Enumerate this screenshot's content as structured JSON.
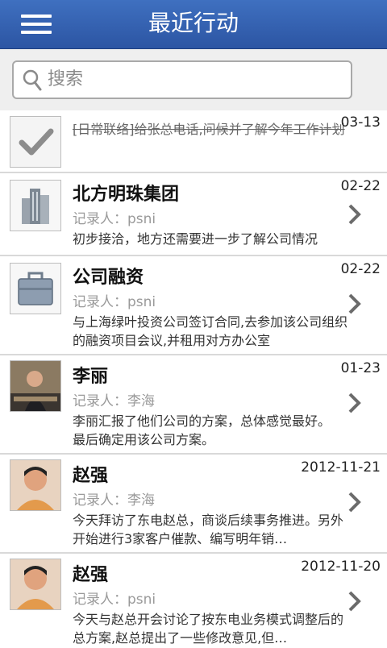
{
  "header": {
    "title": "最近行动"
  },
  "search": {
    "placeholder": "搜索"
  },
  "items": [
    {
      "title": "[日常联络]给张总电话,问候并了解今年工作计划",
      "date": "03-13",
      "recorder": "",
      "desc": ""
    },
    {
      "title": "北方明珠集团",
      "date": "02-22",
      "recorder": "记录人：psni",
      "desc": "初步接洽，地方还需要进一步了解公司情况"
    },
    {
      "title": "公司融资",
      "date": "02-22",
      "recorder": "记录人：psni",
      "desc": "与上海绿叶投资公司签订合同,去参加该公司组织的融资项目会议,并租用对方办公室"
    },
    {
      "title": "李丽",
      "date": "01-23",
      "recorder": "记录人：李海",
      "desc": "李丽汇报了他们公司的方案，总体感觉最好。最后确定用该公司方案。"
    },
    {
      "title": "赵强",
      "date": "2012-11-21",
      "recorder": "记录人：李海",
      "desc": "今天拜访了东电赵总，商谈后续事务推进。另外开始进行3家客户催款、编写明年销…"
    },
    {
      "title": "赵强",
      "date": "2012-11-20",
      "recorder": "记录人：psni",
      "desc": "今天与赵总开会讨论了按东电业务模式调整后的总方案,赵总提出了一些修改意见,但…"
    }
  ]
}
